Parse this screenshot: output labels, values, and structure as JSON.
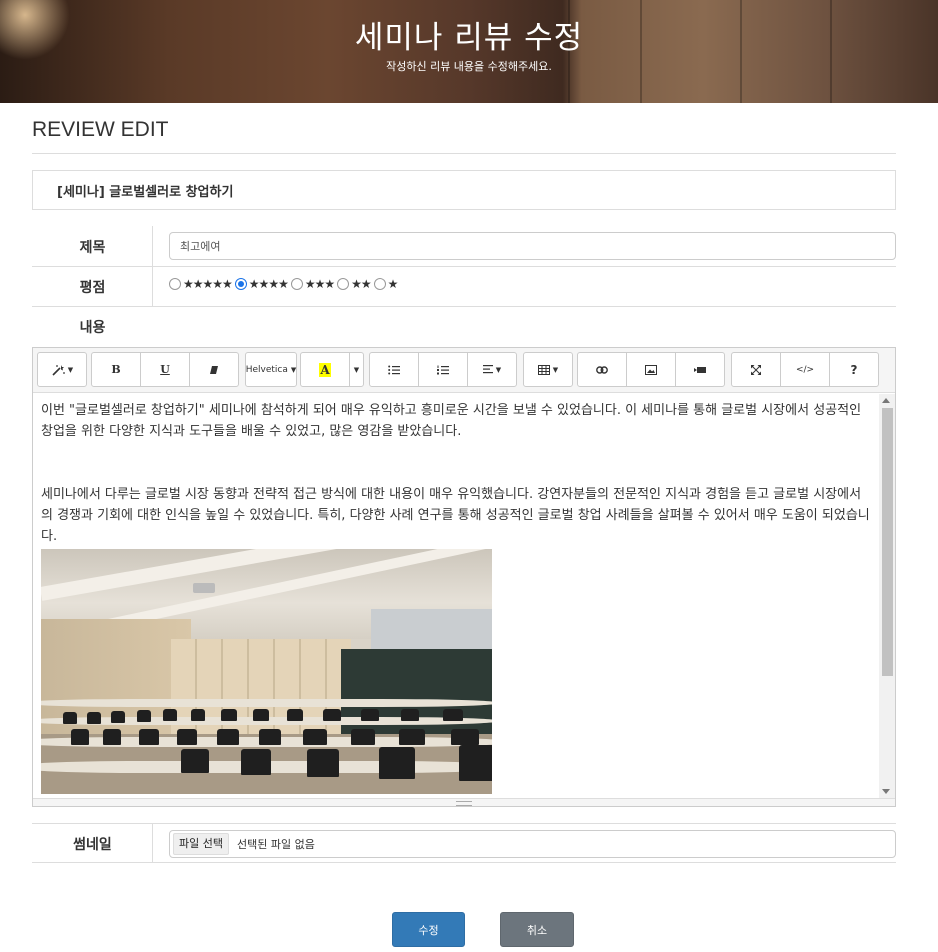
{
  "banner": {
    "title": "세미나 리뷰 수정",
    "subtitle": "작성하신 리뷰 내용을 수정해주세요."
  },
  "section": {
    "heading": "REVIEW EDIT",
    "seminar_name": "[세미나] 글로벌셀러로 창업하기"
  },
  "form": {
    "title_label": "제목",
    "title_value": "최고에여",
    "rating_label": "평점",
    "rating_options": [
      {
        "stars": "★★★★★",
        "checked": false
      },
      {
        "stars": "★★★★",
        "checked": true
      },
      {
        "stars": "★★★",
        "checked": false
      },
      {
        "stars": "★★",
        "checked": false
      },
      {
        "stars": "★",
        "checked": false
      }
    ],
    "content_label": "내용",
    "thumbnail_label": "썸네일",
    "file_button": "파일 선택",
    "file_status": "선택된 파일 없음"
  },
  "toolbar": {
    "font_name": "Helvetica",
    "bold": "B",
    "underline": "U",
    "color_letter": "A",
    "help": "?",
    "code": "</>"
  },
  "editor": {
    "paragraph1": "이번 \"글로벌셀러로 창업하기\" 세미나에 참석하게 되어 매우 유익하고 흥미로운 시간을 보낼 수 있었습니다. 이 세미나를 통해 글로벌 시장에서 성공적인 창업을 위한 다양한 지식과 도구들을 배울 수 있었고, 많은 영감을 받았습니다.",
    "paragraph2": "세미나에서 다루는 글로벌 시장 동향과 전략적 접근 방식에 대한 내용이 매우 유익했습니다. 강연자분들의 전문적인 지식과 경험을 듣고 글로벌 시장에서의 경쟁과 기회에 대한 인식을 높일 수 있었습니다. 특히, 다양한 사례 연구를 통해 성공적인 글로벌 창업 사례들을 살펴볼 수 있어서 매우 도움이 되었습니다."
  },
  "actions": {
    "submit": "수정",
    "cancel": "취소"
  },
  "colors": {
    "primary": "#337ab7",
    "secondary": "#6c757d",
    "radio_accent": "#1a73e8"
  }
}
